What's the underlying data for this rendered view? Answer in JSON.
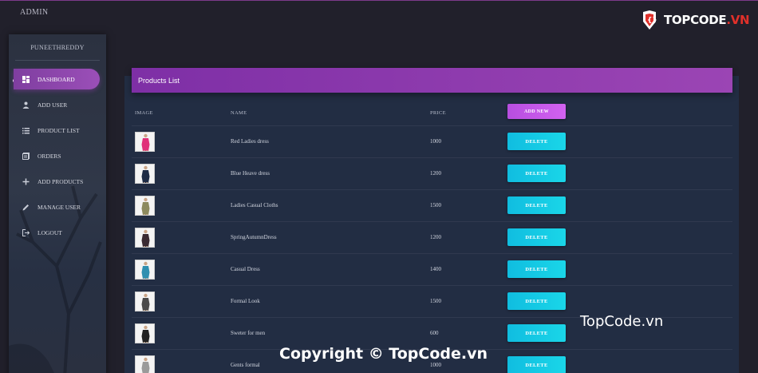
{
  "topbar": {
    "brand": "ADMIN"
  },
  "logo": {
    "name": "TOPCODE",
    "suffix": ".VN"
  },
  "sidebar": {
    "username": "PUNEETHREDDY",
    "items": [
      {
        "label": "DASHBOARD",
        "icon": "dashboard-icon",
        "active": true
      },
      {
        "label": "ADD USER",
        "icon": "person-icon"
      },
      {
        "label": "PRODUCT LIST",
        "icon": "list-icon"
      },
      {
        "label": "ORDERS",
        "icon": "orders-icon"
      },
      {
        "label": "ADD PRODUCTS",
        "icon": "plus-icon"
      },
      {
        "label": "MANAGE USER",
        "icon": "pencil-icon"
      },
      {
        "label": "LOGOUT",
        "icon": "logout-icon"
      }
    ]
  },
  "panel": {
    "title": "Products List",
    "columns": {
      "image": "IMAGE",
      "name": "NAME",
      "price": "PRICE"
    },
    "add_label": "ADD NEW",
    "delete_label": "DELETE",
    "products": [
      {
        "name": "Red Ladies dress",
        "price": "1000",
        "color": "#e0307a"
      },
      {
        "name": "Blue Heave dress",
        "price": "1200",
        "color": "#1d2b45"
      },
      {
        "name": "Ladies Casual Cloths",
        "price": "1500",
        "color": "#8c8a5e"
      },
      {
        "name": "SpringAutumnDress",
        "price": "1200",
        "color": "#3a2a32"
      },
      {
        "name": "Casual Dress",
        "price": "1400",
        "color": "#2f8fb0"
      },
      {
        "name": "Formal Look",
        "price": "1500",
        "color": "#4a4a4a"
      },
      {
        "name": "Sweter for men",
        "price": "600",
        "color": "#222222"
      },
      {
        "name": "Gents formal",
        "price": "1000",
        "color": "#9a9a9a"
      }
    ]
  },
  "watermark": {
    "site": "TopCode.vn",
    "copyright": "Copyright © TopCode.vn"
  },
  "colors": {
    "accent": "#8a3bab",
    "delete": "#14c8e4",
    "add": "#c457e8",
    "panel": "#222d43"
  }
}
